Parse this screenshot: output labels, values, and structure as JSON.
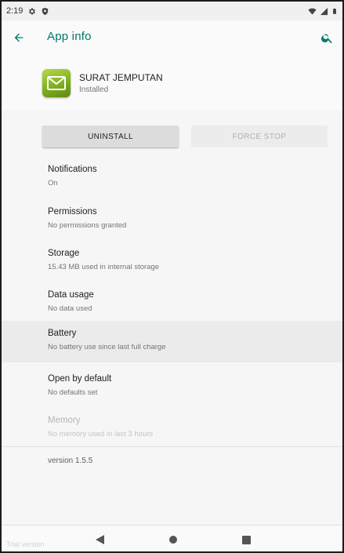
{
  "status_bar": {
    "time": "2:19",
    "icons_left": [
      "gear-icon",
      "shield-icon"
    ],
    "icons_right": [
      "wifi-icon",
      "signal-icon",
      "battery-icon"
    ]
  },
  "app_bar": {
    "title": "App info",
    "accent_color": "#00796b"
  },
  "app": {
    "name": "SURAT JEMPUTAN",
    "state": "Installed",
    "icon": "mail-icon"
  },
  "buttons": {
    "uninstall": "UNINSTALL",
    "force_stop": "FORCE STOP"
  },
  "prefs": [
    {
      "title": "Notifications",
      "summary": "On"
    },
    {
      "title": "Permissions",
      "summary": "No permissions granted"
    },
    {
      "title": "Storage",
      "summary": "15.43 MB used in internal storage"
    },
    {
      "title": "Data usage",
      "summary": "No data used"
    },
    {
      "title": "Battery",
      "summary": "No battery use since last full charge"
    },
    {
      "title": "Open by default",
      "summary": "No defaults set"
    },
    {
      "title": "Memory",
      "summary": "No memory used in last 3 hours"
    }
  ],
  "version": "version 1.5.5",
  "nav": {
    "watermark": "Trial version"
  }
}
